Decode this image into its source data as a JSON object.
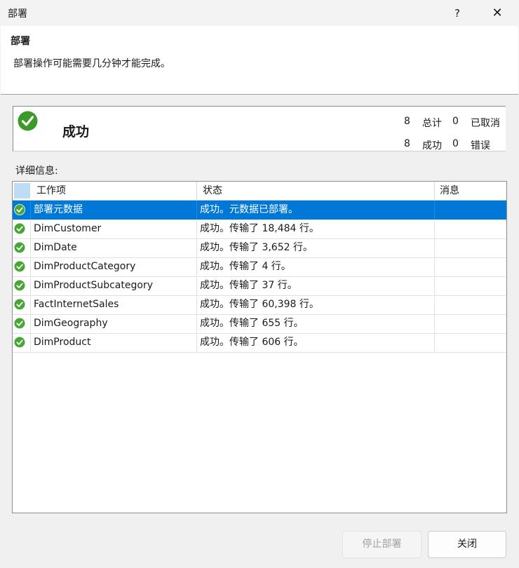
{
  "window": {
    "title": "部署",
    "help_label": "?",
    "close_label": "✕"
  },
  "header": {
    "title": "部署",
    "description": "部署操作可能需要几分钟才能完成。"
  },
  "status": {
    "text": "成功",
    "icon": "success-check-icon",
    "total_count": "8",
    "total_label": "总计",
    "cancelled_count": "0",
    "cancelled_label": "已取消",
    "success_count": "8",
    "success_label": "成功",
    "error_count": "0",
    "error_label": "错误"
  },
  "details": {
    "label": "详细信息:",
    "columns": [
      "工作项",
      "状态",
      "消息"
    ],
    "rows": [
      {
        "item": "部署元数据",
        "status": "成功。元数据已部署。",
        "message": "",
        "icon": "success-check-icon"
      },
      {
        "item": "DimCustomer",
        "status": "成功。传输了 18,484 行。",
        "message": "",
        "icon": "success-check-icon"
      },
      {
        "item": "DimDate",
        "status": "成功。传输了 3,652 行。",
        "message": "",
        "icon": "success-check-icon"
      },
      {
        "item": "DimProductCategory",
        "status": "成功。传输了 4 行。",
        "message": "",
        "icon": "success-check-icon"
      },
      {
        "item": "DimProductSubcategory",
        "status": "成功。传输了 37 行。",
        "message": "",
        "icon": "success-check-icon"
      },
      {
        "item": "FactInternetSales",
        "status": "成功。传输了 60,398 行。",
        "message": "",
        "icon": "success-check-icon"
      },
      {
        "item": "DimGeography",
        "status": "成功。传输了 655 行。",
        "message": "",
        "icon": "success-check-icon"
      },
      {
        "item": "DimProduct",
        "status": "成功。传输了 606 行。",
        "message": "",
        "icon": "success-check-icon"
      }
    ]
  },
  "buttons": {
    "stop_label": "停止部署",
    "close_label": "关闭"
  },
  "colors": {
    "selection": "#0078d7",
    "success_green": "#3c9a2b"
  }
}
